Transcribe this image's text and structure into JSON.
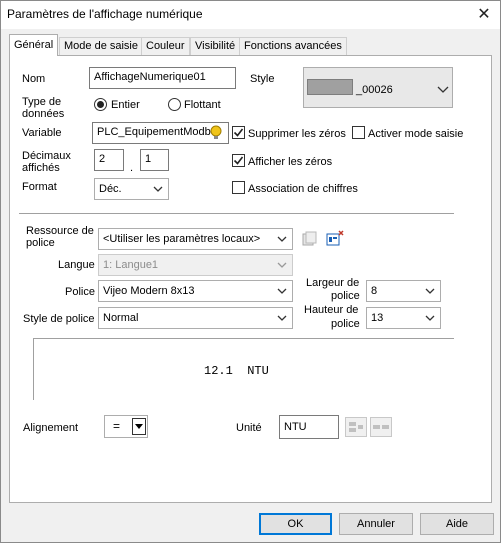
{
  "window": {
    "title": "Paramètres de l'affichage numérique",
    "close": "✕"
  },
  "tabs": [
    "Général",
    "Mode de saisie",
    "Couleur",
    "Visibilité",
    "Fonctions avancées"
  ],
  "form": {
    "nom_label": "Nom",
    "nom_value": "AffichageNumerique01",
    "style_label": "Style",
    "style_value": "_00026",
    "type_label_1": "Type de",
    "type_label_2": "données",
    "radio_entier": "Entier",
    "radio_flottant": "Flottant",
    "variable_label": "Variable",
    "variable_value": "PLC_EquipementModb",
    "supprimer_zeros": "Supprimer les zéros",
    "activer_saisie": "Activer mode saisie",
    "decimaux_label_1": "Décimaux",
    "decimaux_label_2": "affichés",
    "decimaux_int": "2",
    "decimaux_dot": ".",
    "decimaux_frac": "1",
    "afficher_zeros": "Afficher les zéros",
    "format_label": "Format",
    "format_value": "Déc.",
    "association_chiffres": "Association de chiffres"
  },
  "font": {
    "ressource_label_1": "Ressource de",
    "ressource_label_2": "police",
    "ressource_value": "<Utiliser les paramètres locaux>",
    "langue_label": "Langue",
    "langue_value": "1: Langue1",
    "police_label": "Police",
    "police_value": "Vijeo Modern 8x13",
    "largeur_label_1": "Largeur de",
    "largeur_label_2": "police",
    "largeur_value": "8",
    "style_police_label": "Style de police",
    "style_police_value": "Normal",
    "hauteur_label_1": "Hauteur de",
    "hauteur_label_2": "police",
    "hauteur_value": "13"
  },
  "preview": {
    "text": "12.1  NTU"
  },
  "bottom": {
    "alignement_label": "Alignement",
    "alignement_symbol": "=",
    "unite_label": "Unité",
    "unite_value": "NTU"
  },
  "buttons": {
    "ok": "OK",
    "annuler": "Annuler",
    "aide": "Aide"
  },
  "colors": {
    "accent": "#0078d7",
    "swatch": "#a0a0a0",
    "bulb": "#f0c419"
  }
}
